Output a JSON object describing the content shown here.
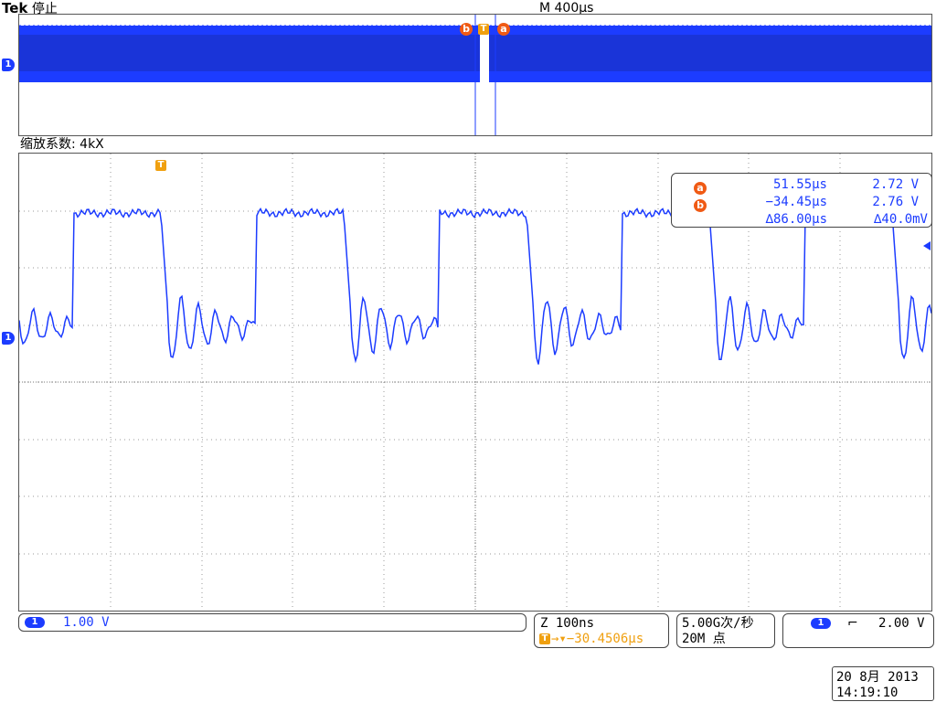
{
  "header": {
    "brand": "Tek",
    "state": "停止",
    "timebase": "M 400µs"
  },
  "overview": {
    "cursor_b_label": "b",
    "trigger_label": "T",
    "cursor_a_label": "a",
    "channel_label": "1"
  },
  "zoom": {
    "label": "缩放系数: 4kX",
    "trigger_label": "T",
    "channel_label": "1"
  },
  "cursor_readout": {
    "a_label": "a",
    "a_time": "51.55µs",
    "a_volt": "2.72 V",
    "b_label": "b",
    "b_time": "−34.45µs",
    "b_volt": "2.76 V",
    "delta_time": "∆86.00µs",
    "delta_volt": "∆40.0mV"
  },
  "status_bar": {
    "ch1_label": "1",
    "ch1_scale": "1.00 V",
    "zoom_scale": "Z 100ns",
    "trigger_label": "T",
    "trigger_offset": "→▾−30.4506µs",
    "sample_rate": "5.00G次/秒",
    "record_length": "20M 点",
    "trig_channel_label": "1",
    "trig_edge_symbol": "⌐",
    "trig_level": "2.00 V"
  },
  "datetime": {
    "date": "20 8月  2013",
    "time": "14:19:10"
  },
  "colors": {
    "trace": "#1c3cff",
    "cursor_orange": "#f05a14",
    "trigger_orange": "#f0a010",
    "grid": "#888888"
  },
  "icons": [
    "channel-marker-icon",
    "trigger-marker-icon",
    "cursor-a-icon",
    "cursor-b-icon",
    "falling-edge-icon"
  ]
}
